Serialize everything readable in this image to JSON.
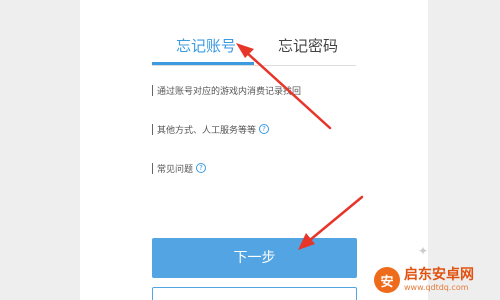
{
  "tabs": {
    "active_label": "忘记账号",
    "inactive_label": "忘记密码"
  },
  "options": [
    {
      "text": "通过账号对应的游戏内消费记录找回",
      "has_help": false
    },
    {
      "text": "其他方式、人工服务等等",
      "has_help": true
    },
    {
      "text": "常见问题",
      "has_help": true
    }
  ],
  "help_glyph": "?",
  "next_button": {
    "label": "下一步"
  },
  "watermark": {
    "logo_char": "安",
    "title": "启东安卓网",
    "url": "www.qdtdq.com"
  },
  "colors": {
    "accent": "#3b9ae0",
    "button": "#52a4e2",
    "arrow": "#e8352a"
  }
}
